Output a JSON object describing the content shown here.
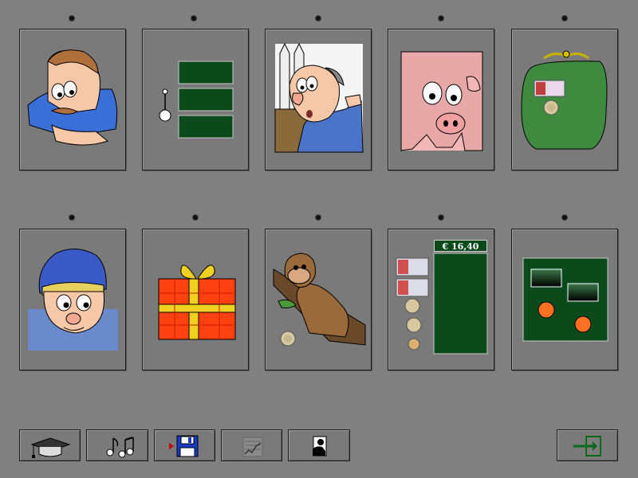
{
  "app": {
    "background": "#808080"
  },
  "cards": [
    {
      "id": "card-man-thinking",
      "icon": "thinking-man-icon"
    },
    {
      "id": "card-green-bars",
      "icon": "bars-icon"
    },
    {
      "id": "card-bald-man-bottles",
      "icon": "shopkeeper-icon"
    },
    {
      "id": "card-pig",
      "icon": "pig-icon"
    },
    {
      "id": "card-money-bag",
      "icon": "money-bag-icon"
    },
    {
      "id": "card-boy-blue-cap",
      "icon": "boy-icon"
    },
    {
      "id": "card-gift",
      "icon": "gift-icon"
    },
    {
      "id": "card-monkey",
      "icon": "monkey-icon"
    },
    {
      "id": "card-cash-register",
      "icon": "cash-icon",
      "amount_label": "€ 16,40"
    },
    {
      "id": "card-board-game",
      "icon": "board-game-icon"
    }
  ],
  "toolbar": {
    "items": [
      {
        "name": "graduation-cap-button",
        "icon": "graduation-cap-icon"
      },
      {
        "name": "music-button",
        "icon": "music-notes-icon"
      },
      {
        "name": "save-button",
        "icon": "floppy-disk-icon"
      },
      {
        "name": "chart-button",
        "icon": "line-chart-icon"
      },
      {
        "name": "profile-button",
        "icon": "person-icon"
      },
      {
        "name": "exit-button",
        "icon": "exit-icon"
      }
    ]
  },
  "colors": {
    "board_green": "#0c4a1c",
    "bag_green": "#3e8a3e",
    "gift_orange": "#ff4010",
    "gift_yellow": "#f0d020"
  }
}
